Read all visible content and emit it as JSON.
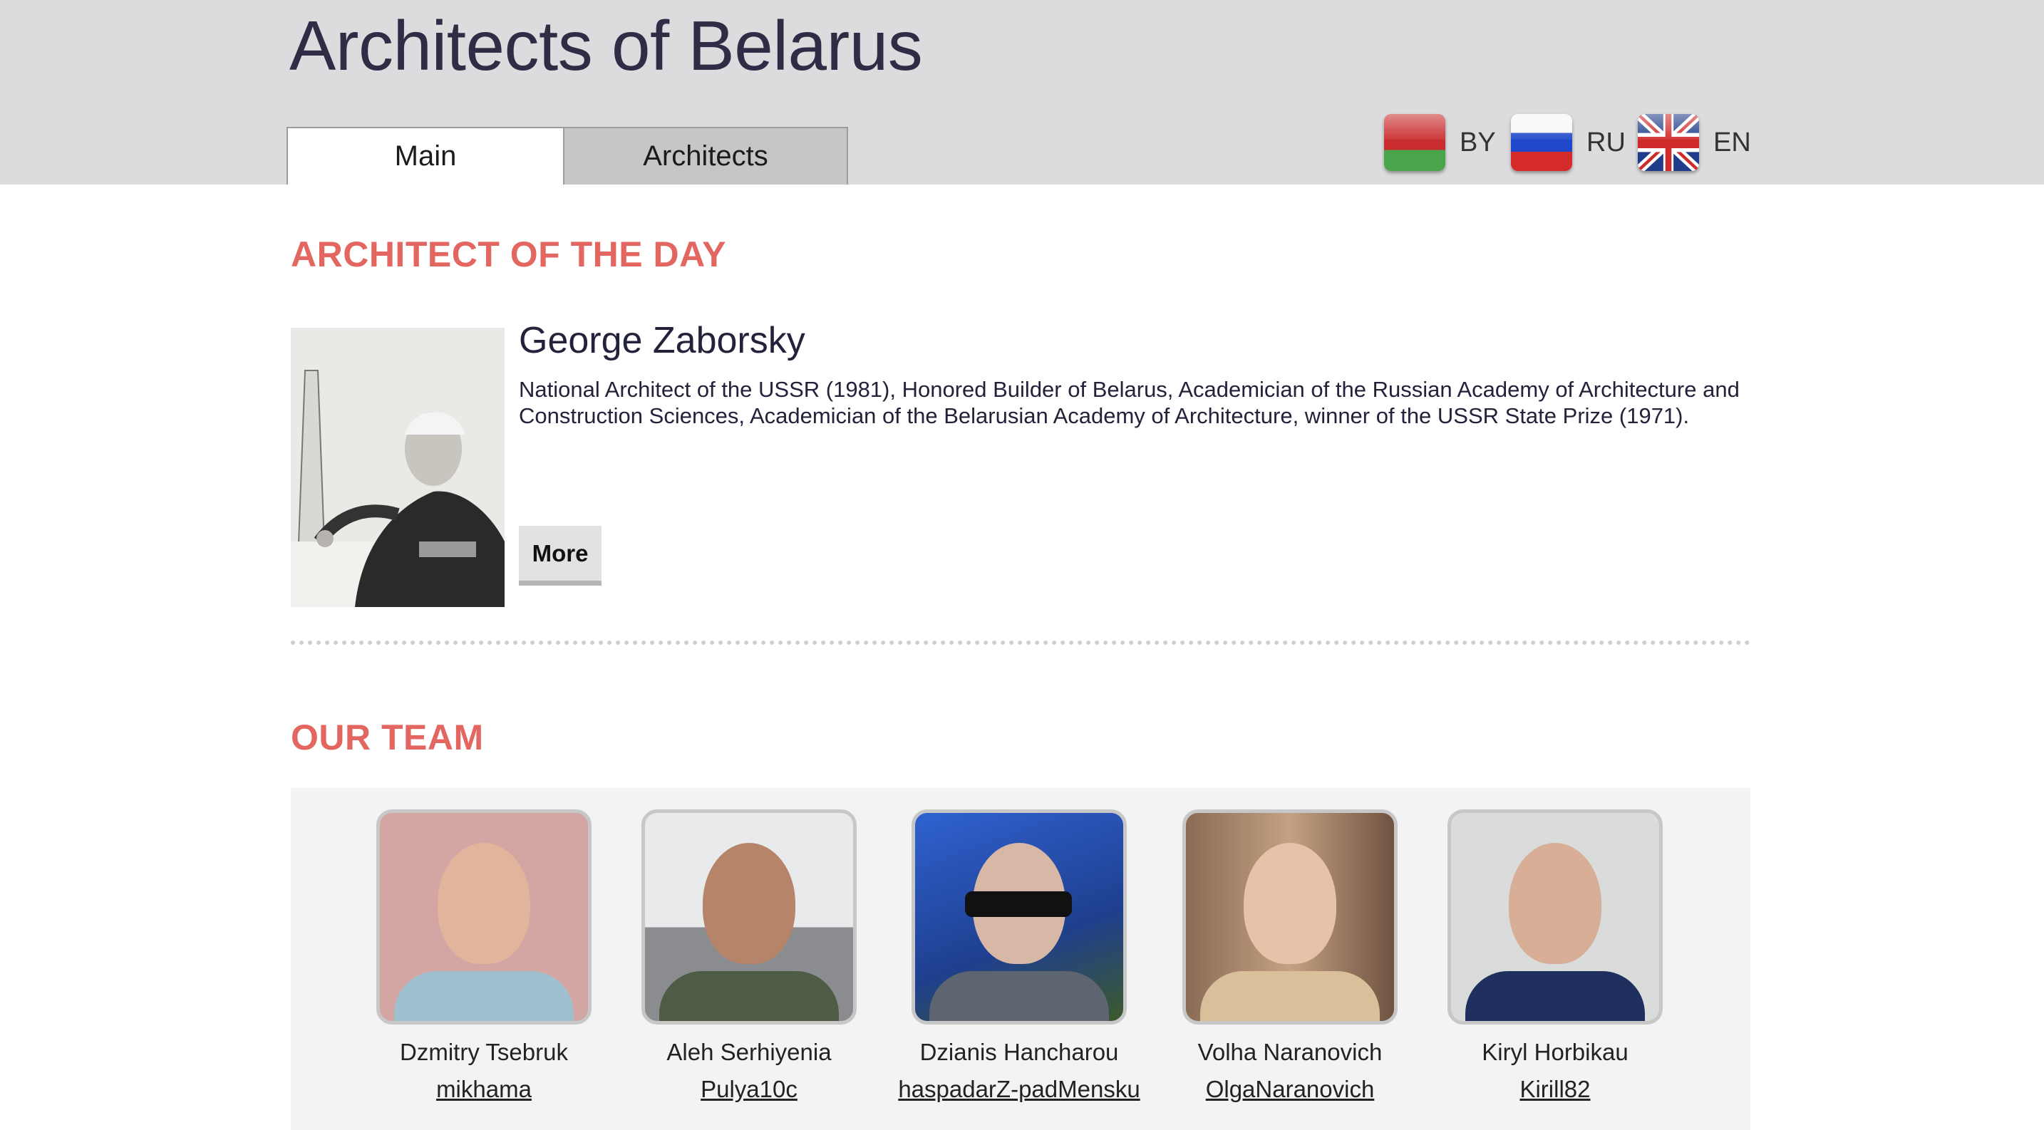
{
  "header": {
    "title": "Architects of Belarus",
    "tabs": [
      {
        "label": "Main",
        "active": true
      },
      {
        "label": "Architects",
        "active": false
      }
    ],
    "languages": [
      {
        "code": "BY",
        "icon": "belarus-flag-icon"
      },
      {
        "code": "RU",
        "icon": "russia-flag-icon"
      },
      {
        "code": "EN",
        "icon": "uk-flag-icon"
      }
    ]
  },
  "architect_of_the_day": {
    "heading": "ARCHITECT OF THE DAY",
    "name": "George Zaborsky",
    "description": "National Architect of the USSR (1981), Honored Builder of Belarus, Academician of the Russian Academy of Architecture and Construction Sciences, Academician of the Belarusian Academy of Architecture, winner of the USSR State Prize (1971).",
    "more_label": "More"
  },
  "team": {
    "heading": "OUR TEAM",
    "members": [
      {
        "name": "Dzmitry Tsebruk",
        "nick": "mikhama"
      },
      {
        "name": "Aleh Serhiyenia",
        "nick": "Pulya10c"
      },
      {
        "name": "Dzianis Hancharou",
        "nick": "haspadarZ-padMensku"
      },
      {
        "name": "Volha Naranovich",
        "nick": "OlgaNaranovich"
      },
      {
        "name": "Kiryl Horbikau",
        "nick": "Kirill82"
      }
    ]
  },
  "colors": {
    "header_bg": "#dcdcde",
    "accent": "#e36660",
    "team_bg": "#f3f3f3"
  }
}
